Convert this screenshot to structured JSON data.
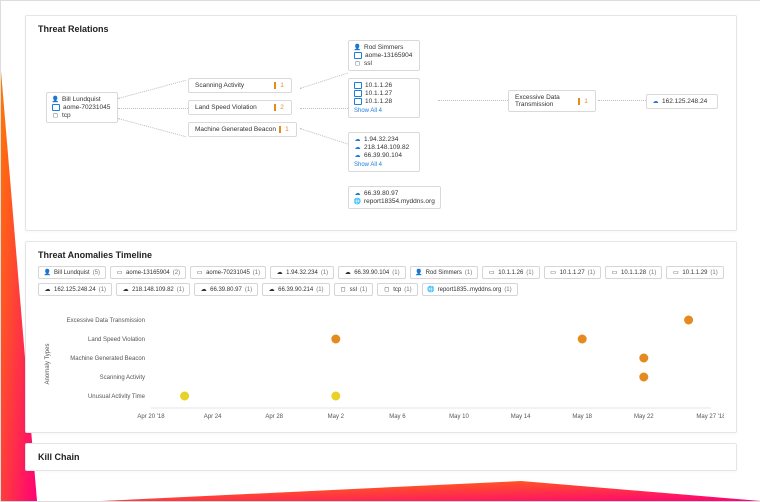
{
  "sections": {
    "relations_title": "Threat Relations",
    "timeline_title": "Threat Anomalies Timeline",
    "killchain_title": "Kill Chain"
  },
  "relations": {
    "root": {
      "user": "Bill Lundquist",
      "host": "aome-70231045",
      "proto": "tcp"
    },
    "threats": [
      {
        "name": "Scanning Activity",
        "count": 1
      },
      {
        "name": "Land Speed Violation",
        "count": 2
      },
      {
        "name": "Machine Generated Beacon",
        "count": 1
      }
    ],
    "group_top": {
      "user": "Rod Simmers",
      "host": "aome-13165904",
      "proto": "ssl"
    },
    "ips_a": [
      "10.1.1.26",
      "10.1.1.27",
      "10.1.1.28"
    ],
    "ips_a_more": "Show All 4",
    "ips_b": [
      "1.94.32.234",
      "218.148.109.82",
      "66.39.90.104"
    ],
    "ips_b_more": "Show All 4",
    "ips_c_ip": "66.39.80.97",
    "ips_c_host": "report18354.myddns.org",
    "right_threat": {
      "name": "Excessive Data Transmission",
      "count": 1
    },
    "right_ip": "162.125.248.24"
  },
  "timeline_chips": [
    {
      "icon": "user",
      "label": "Bill Lundquist",
      "count": 5
    },
    {
      "icon": "mon",
      "label": "aome-13165904",
      "count": 2
    },
    {
      "icon": "mon",
      "label": "aome-70231045",
      "count": 1
    },
    {
      "icon": "net",
      "label": "1.94.32.234",
      "count": 1
    },
    {
      "icon": "net",
      "label": "66.39.90.104",
      "count": 1
    },
    {
      "icon": "user",
      "label": "Rod Simmers",
      "count": 1
    },
    {
      "icon": "mon",
      "label": "10.1.1.26",
      "count": 1
    },
    {
      "icon": "mon",
      "label": "10.1.1.27",
      "count": 1
    },
    {
      "icon": "mon",
      "label": "10.1.1.28",
      "count": 1
    },
    {
      "icon": "mon",
      "label": "10.1.1.29",
      "count": 1
    },
    {
      "icon": "net",
      "label": "162.125.248.24",
      "count": 1
    },
    {
      "icon": "net",
      "label": "218.148.109.82",
      "count": 1
    },
    {
      "icon": "net",
      "label": "66.39.80.97",
      "count": 1
    },
    {
      "icon": "net",
      "label": "66.39.90.214",
      "count": 1
    },
    {
      "icon": "proto",
      "label": "ssl",
      "count": 1
    },
    {
      "icon": "proto",
      "label": "tcp",
      "count": 1
    },
    {
      "icon": "host",
      "label": "report1835..myddns.org",
      "count": 1
    }
  ],
  "chart_data": {
    "type": "scatter",
    "title": "Threat Anomalies Timeline",
    "xlabel": "",
    "ylabel": "Anomaly Types",
    "y_categories": [
      "Excessive Data Transmission",
      "Land Speed Violation",
      "Machine Generated Beacon",
      "Scanning Activity",
      "Unusual Activity Time"
    ],
    "x_ticks": [
      "Apr 20 '18",
      "Apr 24",
      "Apr 28",
      "May 2",
      "May 6",
      "May 10",
      "May 14",
      "May 18",
      "May 22",
      "May 27 '18"
    ],
    "series": [
      {
        "name": "orange",
        "color": "#e58a1f",
        "points": [
          {
            "x": "May 2",
            "y": "Land Speed Violation"
          },
          {
            "x": "May 18",
            "y": "Land Speed Violation"
          },
          {
            "x": "May 22",
            "y": "Machine Generated Beacon"
          },
          {
            "x": "May 22",
            "y": "Scanning Activity"
          },
          {
            "x": "May 26",
            "y": "Excessive Data Transmission"
          }
        ]
      },
      {
        "name": "yellow",
        "color": "#e8d226",
        "points": [
          {
            "x": "Apr 22",
            "y": "Unusual Activity Time"
          },
          {
            "x": "May 2",
            "y": "Unusual Activity Time"
          }
        ]
      }
    ]
  }
}
